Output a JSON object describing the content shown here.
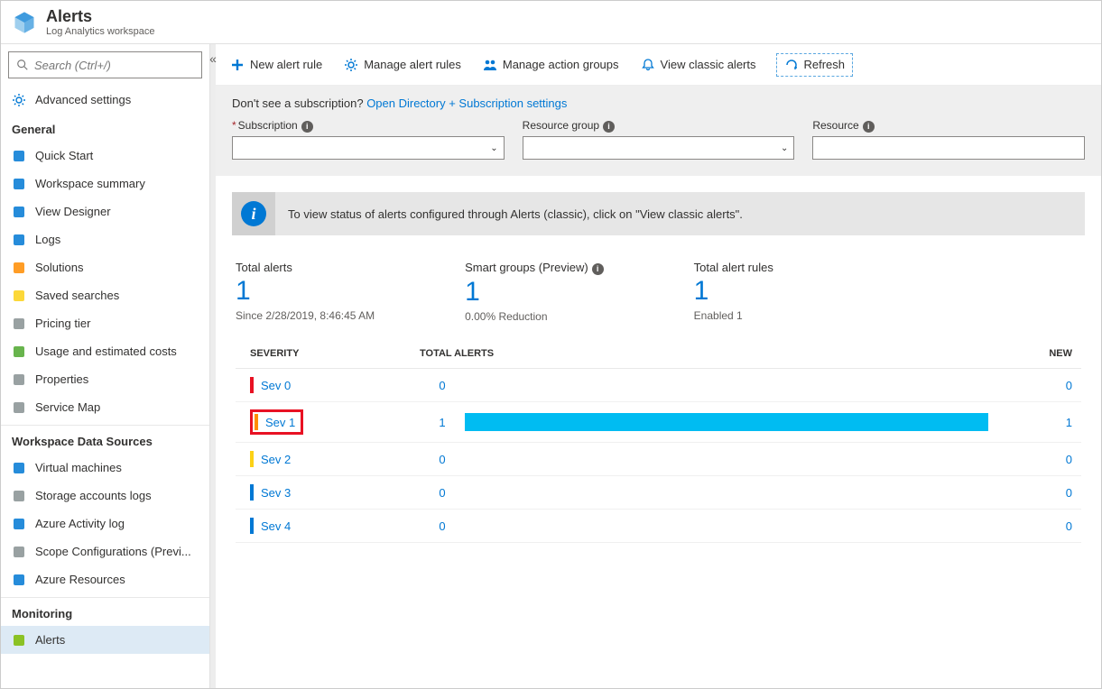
{
  "header": {
    "title": "Alerts",
    "subtitle": "Log Analytics workspace"
  },
  "search": {
    "placeholder": "Search (Ctrl+/)"
  },
  "sidebar": {
    "advanced": "Advanced settings",
    "sections": [
      {
        "title": "General",
        "items": [
          {
            "label": "Quick Start",
            "icon": "cloud",
            "color": "#0078d4"
          },
          {
            "label": "Workspace summary",
            "icon": "summary",
            "color": "#0078d4"
          },
          {
            "label": "View Designer",
            "icon": "designer",
            "color": "#0078d4"
          },
          {
            "label": "Logs",
            "icon": "logs",
            "color": "#0078d4"
          },
          {
            "label": "Solutions",
            "icon": "solutions",
            "color": "#ff8c00"
          },
          {
            "label": "Saved searches",
            "icon": "star",
            "color": "#fcd116"
          },
          {
            "label": "Pricing tier",
            "icon": "bars",
            "color": "#879092"
          },
          {
            "label": "Usage and estimated costs",
            "icon": "usage",
            "color": "#4ea72e"
          },
          {
            "label": "Properties",
            "icon": "bars",
            "color": "#879092"
          },
          {
            "label": "Service Map",
            "icon": "map",
            "color": "#879092"
          }
        ]
      },
      {
        "title": "Workspace Data Sources",
        "items": [
          {
            "label": "Virtual machines",
            "icon": "vm",
            "color": "#0078d4"
          },
          {
            "label": "Storage accounts logs",
            "icon": "storage",
            "color": "#879092"
          },
          {
            "label": "Azure Activity log",
            "icon": "activity",
            "color": "#0078d4"
          },
          {
            "label": "Scope Configurations (Previ...",
            "icon": "scope",
            "color": "#879092"
          },
          {
            "label": "Azure Resources",
            "icon": "cube",
            "color": "#0078d4"
          }
        ]
      },
      {
        "title": "Monitoring",
        "items": [
          {
            "label": "Alerts",
            "icon": "alert",
            "color": "#7cbb00",
            "active": true
          }
        ]
      }
    ]
  },
  "toolbar": {
    "new_rule": "New alert rule",
    "manage_rules": "Manage alert rules",
    "manage_groups": "Manage action groups",
    "classic": "View classic alerts",
    "refresh": "Refresh"
  },
  "filter": {
    "note_prefix": "Don't see a subscription? ",
    "note_link": "Open Directory + Subscription settings",
    "subscription": "Subscription",
    "resource_group": "Resource group",
    "resource": "Resource"
  },
  "banner": {
    "msg": "To view status of alerts configured through Alerts (classic), click on \"View classic alerts\"."
  },
  "stats": {
    "total": {
      "label": "Total alerts",
      "value": "1",
      "sub": "Since 2/28/2019, 8:46:45 AM"
    },
    "smart": {
      "label": "Smart groups (Preview)",
      "value": "1",
      "sub": "0.00% Reduction"
    },
    "rules": {
      "label": "Total alert rules",
      "value": "1",
      "sub": "Enabled 1"
    }
  },
  "table": {
    "headers": {
      "severity": "SEVERITY",
      "total": "TOTAL ALERTS",
      "new": "NEW"
    },
    "rows": [
      {
        "sev": "Sev 0",
        "color": "#e81123",
        "total": "0",
        "new": "0",
        "bar": 0,
        "highlight": false
      },
      {
        "sev": "Sev 1",
        "color": "#ff8c00",
        "total": "1",
        "new": "1",
        "bar": 100,
        "highlight": true
      },
      {
        "sev": "Sev 2",
        "color": "#fcd116",
        "total": "0",
        "new": "0",
        "bar": 0,
        "highlight": false
      },
      {
        "sev": "Sev 3",
        "color": "#0078d4",
        "total": "0",
        "new": "0",
        "bar": 0,
        "highlight": false
      },
      {
        "sev": "Sev 4",
        "color": "#0078d4",
        "total": "0",
        "new": "0",
        "bar": 0,
        "highlight": false
      }
    ]
  }
}
